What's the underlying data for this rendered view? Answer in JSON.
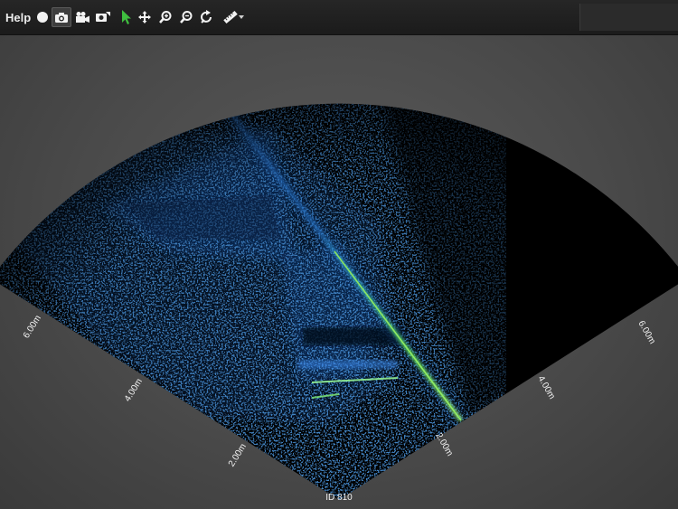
{
  "toolbar": {
    "help_label": "Help",
    "icons": [
      "record-icon",
      "camera-icon",
      "video-camera-icon",
      "snapshot-icon",
      "pointer-icon",
      "pan-icon",
      "zoom-in-icon",
      "zoom-out-icon",
      "reset-icon",
      "ruler-icon",
      "chevron-down-icon"
    ]
  },
  "sonar": {
    "range_unit": "m",
    "left_scale": [
      "2.00m",
      "4.00m",
      "6.00m"
    ],
    "right_scale": [
      "2.00m",
      "4.00m",
      "6.00m"
    ],
    "device_label": "ID 810",
    "colors": {
      "background": "#4a4a4a",
      "fan": "#000000",
      "echo": "#1e6fd0",
      "strong_echo": "#7dff3a"
    }
  }
}
